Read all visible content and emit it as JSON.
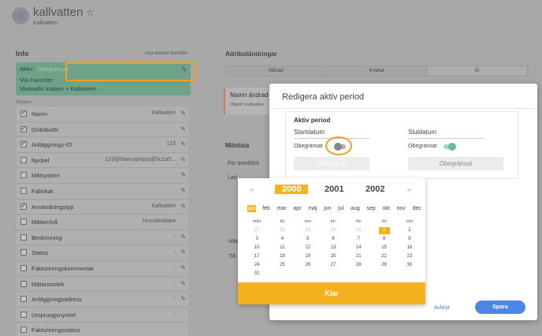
{
  "header": {
    "title": "kallvatten",
    "subtitle": "Kallvatten",
    "star": "☆"
  },
  "info": {
    "title": "Info",
    "favorites_link": "visa endast favoriter",
    "active_label": "Aktiv:",
    "active_value": "Obegränsat",
    "via_label": "Via Favoriter",
    "via_value": "",
    "path": "Manuella mätare > Kallvatten",
    "section_label": "Mätare"
  },
  "rows": [
    {
      "label": "Namn",
      "value": "Kallvatten",
      "checked": true,
      "edit": true
    },
    {
      "label": "Distributör",
      "value": "",
      "checked": true,
      "edit": true
    },
    {
      "label": "Anläggnings-ID",
      "value": "123",
      "checked": true,
      "edit": true
    },
    {
      "label": "Nyckel",
      "value": "123@ManualInput@5c1a5...",
      "checked": false,
      "edit": true
    },
    {
      "label": "Mätsystem",
      "value": "",
      "checked": false,
      "edit": true
    },
    {
      "label": "Fabrikat",
      "value": "-",
      "checked": false,
      "edit": true
    },
    {
      "label": "Användningstyp",
      "value": "Kallvatten",
      "checked": true,
      "edit": true
    },
    {
      "label": "Mätarnivå",
      "value": "Huvudmätare",
      "checked": false,
      "edit": false
    },
    {
      "label": "Beskrivning",
      "value": "-",
      "checked": false,
      "edit": true
    },
    {
      "label": "Status",
      "value": "-",
      "checked": false,
      "edit": true
    },
    {
      "label": "Faktureringskommentar",
      "value": "-",
      "checked": false,
      "edit": true
    },
    {
      "label": "Mätarstorlek",
      "value": "-",
      "checked": false,
      "edit": true
    },
    {
      "label": "Anläggningsadress",
      "value": "-",
      "checked": false,
      "edit": true
    },
    {
      "label": "Ursprungsnyckel",
      "value": "-",
      "checked": false,
      "edit": false
    },
    {
      "label": "Faktureringsstatus",
      "value": "",
      "checked": false,
      "edit": false
    }
  ],
  "attributes": {
    "title": "Attributändringar",
    "tabs": [
      "Månad",
      "Kvartal",
      "År"
    ],
    "card_title": "Namn ändrad",
    "card_sub": "Objekt: Kallvatten"
  },
  "matdata": {
    "title": "Mätdata",
    "overview": "För överblick",
    "lad": "Lad",
    "mat": "Mät",
    "till": "Till"
  },
  "modal": {
    "title": "Redigera aktiv period",
    "section": "Aktiv period",
    "start_label": "Startdatum",
    "end_label": "Slutdatum",
    "unlimited": "Obegränsat",
    "start_input": "2000-01-01",
    "end_input": "Obegränsat",
    "cancel": "Avbryt",
    "save": "Spara"
  },
  "calendar": {
    "prev": "«",
    "next": "»",
    "years": [
      "2000",
      "2001",
      "2002"
    ],
    "selected_year": "2000",
    "months": [
      "jan",
      "feb",
      "mar",
      "apr",
      "maj",
      "jun",
      "jul",
      "aug",
      "sep",
      "okt",
      "nov",
      "dec"
    ],
    "selected_month": "jan",
    "weekdays": [
      "mån",
      "tis",
      "ons",
      "tor",
      "fre",
      "lör",
      "sön"
    ],
    "weeks": [
      [
        "27",
        "28",
        "29",
        "30",
        "31",
        "1",
        "2"
      ],
      [
        "3",
        "4",
        "5",
        "6",
        "7",
        "8",
        "9"
      ],
      [
        "10",
        "11",
        "12",
        "13",
        "14",
        "15",
        "16"
      ],
      [
        "17",
        "18",
        "19",
        "20",
        "21",
        "22",
        "23"
      ],
      [
        "24",
        "25",
        "26",
        "27",
        "28",
        "29",
        "30"
      ],
      [
        "31",
        "",
        "",
        "",
        "",
        "",
        ""
      ]
    ],
    "done": "Klar"
  }
}
